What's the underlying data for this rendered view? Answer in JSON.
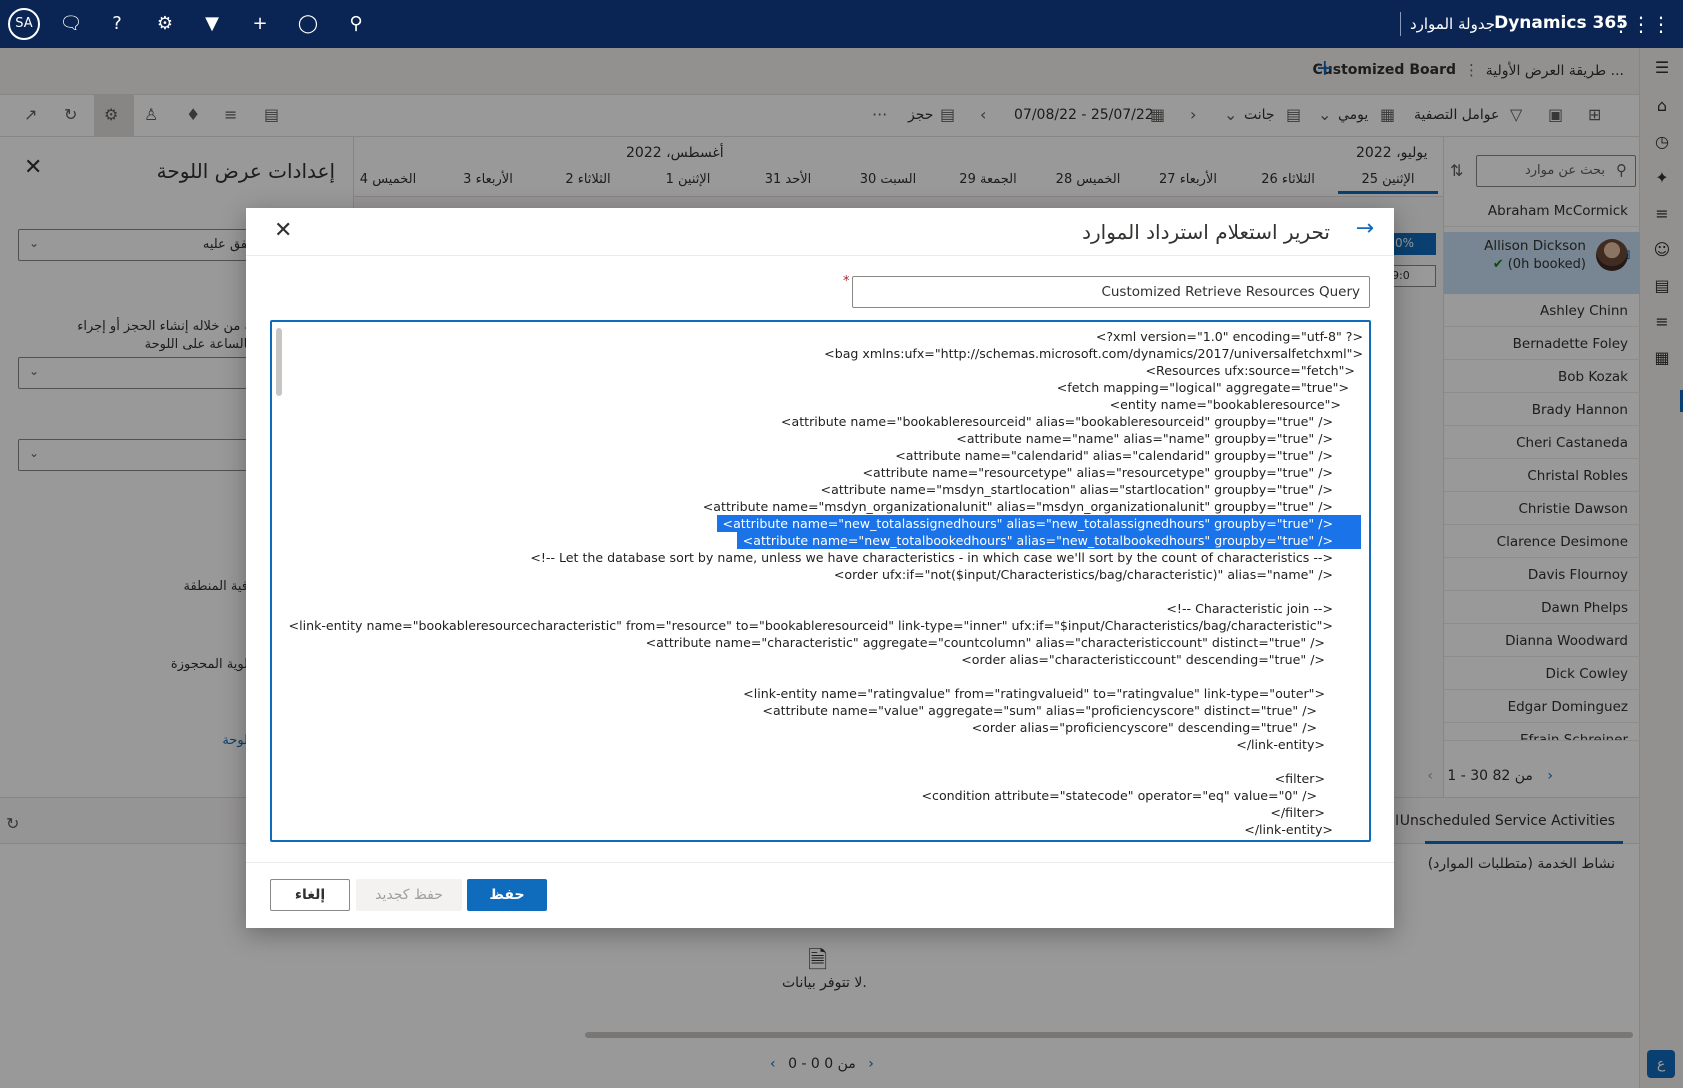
{
  "topbar": {
    "avatar_initials": "SA",
    "app_name": "جدولة الموارد",
    "brand": "Dynamics 365"
  },
  "tabs": {
    "initial_view": "طريقة العرض الأولية ...",
    "customized_board": "Customized Board"
  },
  "toolbar": {
    "book_label": "حجز",
    "date_range": "07/08/22 - 25/07/22",
    "view_gantt": "جانت",
    "view_daily": "يومي",
    "filters_label": "عوامل التصفية"
  },
  "schedule": {
    "month_july": "يوليو، 2022",
    "month_august": "أغسطس، 2022",
    "days": [
      "الإثنين 25",
      "الثلاثاء 26",
      "الأربعاء 27",
      "الخميس 28",
      "الجمعة 29",
      "السبت 30",
      "الأحد 31",
      "الإثنين 1",
      "الثلاثاء 2",
      "الأربعاء 3",
      "الخميس 4"
    ]
  },
  "resources": {
    "search_placeholder": "بحث عن موارد",
    "list": [
      "Abraham McCormick",
      "Ashley Chinn",
      "Bernadette Foley",
      "Bob Kozak",
      "Brady Hannon",
      "Cheri Castaneda",
      "Christal Robles",
      "Christie Dawson",
      "Clarence Desimone",
      "Davis Flournoy",
      "Dawn Phelps",
      "Dianna Woodward",
      "Dick Cowley",
      "Edgar Dominguez",
      "Efrain Schreiner"
    ],
    "selected_name": "Allison Dickson",
    "selected_sub": "(0h booked)",
    "pager": "1 - 30 من 82",
    "percent_fragment": "0%",
    "time_fragment": "09:0"
  },
  "left_panel": {
    "title": "إعدادات عرض اللوحة",
    "dropdown1": "ب العالمي المتفق عليه",
    "helper_text_1": "صغر الذي يمكنك من خلاله إنشاء الحجز أو إجراء",
    "helper_text_2": "طريقة العرض بالساعة على اللوحة.",
    "filter_region": "فية المنطقة",
    "priority_booked": "لوية المحجوزة",
    "board_link": "لوحة"
  },
  "lower": {
    "tab_unscheduled": "Unscheduled Service Activities",
    "tab_other": "المت",
    "subtitle": "نشاط الخدمة (متطلبات الموارد)",
    "no_data": "لا تتوفر بيانات.",
    "pager": "0 - 0 من 0"
  },
  "dialog": {
    "title": "تحرير استعلام استرداد الموارد",
    "query_name": "Customized Retrieve Resources Query",
    "xml_lines": [
      "<?xml version=\"1.0\" encoding=\"utf-8\" ?>",
      "<bag xmlns:ufx=\"http://schemas.microsoft.com/dynamics/2017/universalfetchxml\">",
      "<Resources ufx:source=\"fetch\">",
      "<fetch mapping=\"logical\" aggregate=\"true\">",
      "<entity name=\"bookableresource\">",
      "<attribute name=\"bookableresourceid\" alias=\"bookableresourceid\" groupby=\"true\" />",
      "<attribute name=\"name\" alias=\"name\" groupby=\"true\" />",
      "<attribute name=\"calendarid\" alias=\"calendarid\" groupby=\"true\" />",
      "<attribute name=\"resourcetype\" alias=\"resourcetype\" groupby=\"true\" />",
      "<attribute name=\"msdyn_startlocation\" alias=\"startlocation\" groupby=\"true\" />",
      "<attribute name=\"msdyn_organizationalunit\" alias=\"msdyn_organizationalunit\" groupby=\"true\" />",
      "<attribute name=\"new_totalassignedhours\" alias=\"new_totalassignedhours\" groupby=\"true\" />",
      "<attribute name=\"new_totalbookedhours\" alias=\"new_totalbookedhours\" groupby=\"true\" />",
      "<!-- Let the database sort by name, unless we have characteristics - in which case we'll sort by the count of characteristics -->",
      "<order ufx:if=\"not($input/Characteristics/bag/characteristic)\" alias=\"name\" />",
      "",
      "<!-- Characteristic join -->",
      "<link-entity name=\"bookableresourcecharacteristic\" from=\"resource\" to=\"bookableresourceid\" link-type=\"inner\" ufx:if=\"$input/Characteristics/bag/characteristic\">",
      "<attribute name=\"characteristic\" aggregate=\"countcolumn\" alias=\"characteristiccount\" distinct=\"true\" />",
      "<order alias=\"characteristiccount\" descending=\"true\" />",
      "",
      "<link-entity name=\"ratingvalue\" from=\"ratingvalueid\" to=\"ratingvalue\" link-type=\"outer\">",
      "<attribute name=\"value\" aggregate=\"sum\" alias=\"proficiencyscore\" distinct=\"true\" />",
      "<order alias=\"proficiencyscore\" descending=\"true\" />",
      "</link-entity>",
      "",
      "<filter>",
      "<condition attribute=\"statecode\" operator=\"eq\" value=\"0\" />",
      "</filter>",
      "</link-entity>"
    ],
    "save_label": "حفظ",
    "save_as_label": "حفظ كجديد",
    "cancel_label": "إلغاء"
  }
}
